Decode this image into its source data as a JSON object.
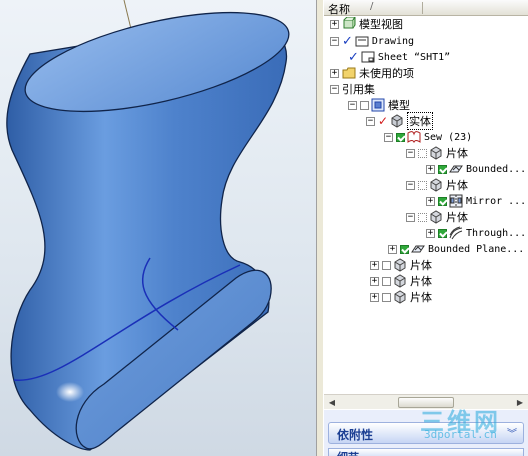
{
  "tree_header": {
    "name_col": "名称",
    "sort_glyph": "/"
  },
  "tree": {
    "root_view": "模型视图",
    "drawing": "Drawing",
    "sheet": "Sheet “SHT1”",
    "unused": "未使用的项",
    "refset": "引用集",
    "model": "模型",
    "solid": "实体",
    "sew": "Sew (23)",
    "sheet_body": "片体",
    "bounded_short": "Bounded...",
    "mirror": "Mirror ...",
    "through": "Through...",
    "bounded_plane": "Bounded Plane..."
  },
  "bottom": {
    "dependency": "依附性",
    "next": "细节"
  },
  "watermark": {
    "brand": "三维网",
    "url": "3dportal.cn"
  },
  "colors": {
    "surface": "#5a8fd2",
    "curve": "#1a2fb8",
    "accent": "#2fa83a"
  }
}
